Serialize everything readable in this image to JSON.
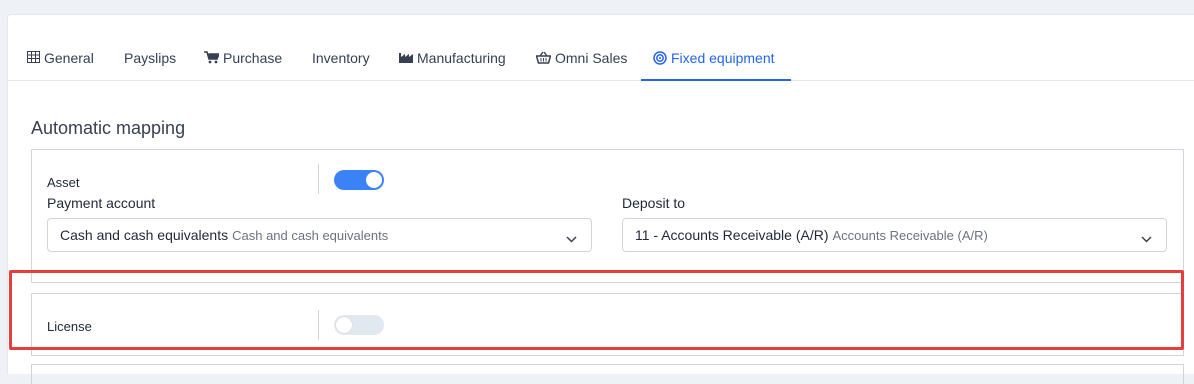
{
  "tabs": [
    {
      "label": "General",
      "icon": "table-icon"
    },
    {
      "label": "Payslips",
      "icon": ""
    },
    {
      "label": "Purchase",
      "icon": "cart-icon"
    },
    {
      "label": "Inventory",
      "icon": ""
    },
    {
      "label": "Manufacturing",
      "icon": "factory-icon"
    },
    {
      "label": "Omni Sales",
      "icon": "basket-icon"
    },
    {
      "label": "Fixed equipment",
      "icon": "target-icon"
    }
  ],
  "active_tab": "Fixed equipment",
  "colors": {
    "accent": "#2563eb",
    "toggle_on": "#3b82f6",
    "toggle_off": "#e2e8f0",
    "highlight": "#e53e3e"
  },
  "section": {
    "title": "Automatic mapping"
  },
  "asset": {
    "label": "Asset",
    "enabled": true,
    "payment_account": {
      "label": "Payment account",
      "value_main": "Cash and cash equivalents",
      "value_sub": "Cash and cash equivalents"
    },
    "deposit_to": {
      "label": "Deposit to",
      "value_main": "11 - Accounts Receivable (A/R)",
      "value_sub": "Accounts Receivable (A/R)"
    }
  },
  "license": {
    "label": "License",
    "enabled": false
  }
}
